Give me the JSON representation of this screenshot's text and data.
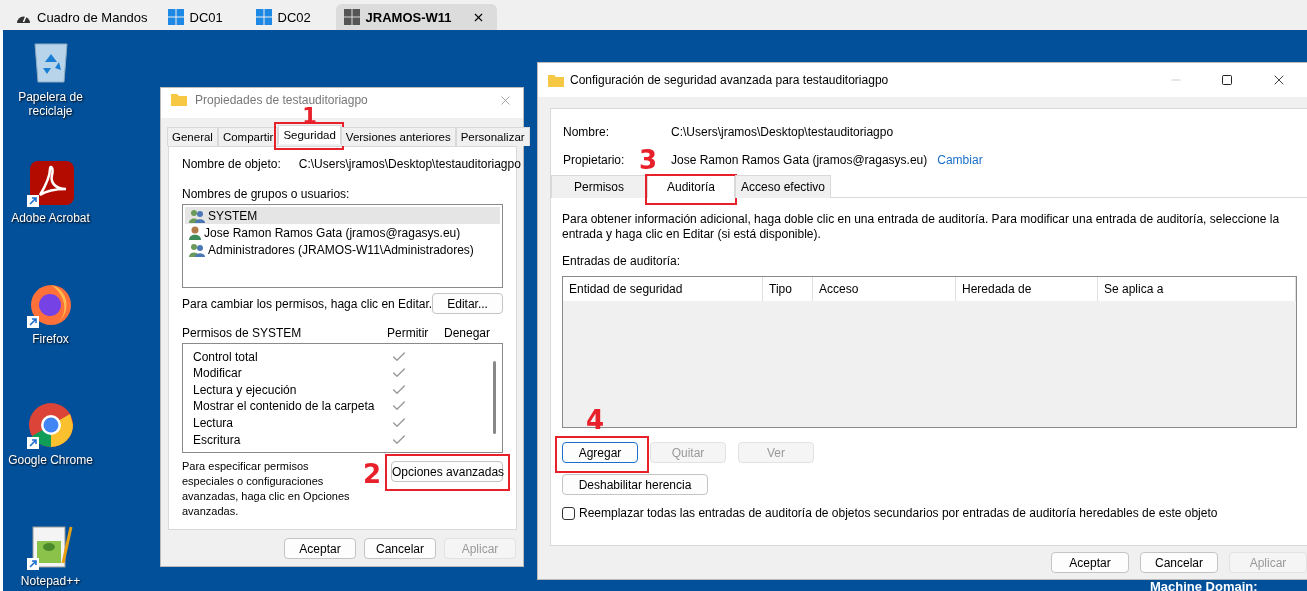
{
  "tabs": [
    {
      "label": "Cuadro de Mandos",
      "selected": false,
      "kind": "dashboard"
    },
    {
      "label": "DC01",
      "selected": false,
      "kind": "windows"
    },
    {
      "label": "DC02",
      "selected": false,
      "kind": "windows"
    },
    {
      "label": "JRAMOS-W11",
      "selected": true,
      "kind": "windows"
    }
  ],
  "desktop_icons": [
    {
      "label": "Papelera de reciclaje",
      "kind": "recycle",
      "shortcut": false
    },
    {
      "label": "Adobe Acrobat",
      "kind": "acrobat",
      "shortcut": true
    },
    {
      "label": "Firefox",
      "kind": "firefox",
      "shortcut": true
    },
    {
      "label": "Google Chrome",
      "kind": "chrome",
      "shortcut": true
    },
    {
      "label": "Notepad++",
      "kind": "notepad",
      "shortcut": true
    }
  ],
  "properties_window": {
    "title": "Propiedades de testauditoriagpo",
    "tabs": [
      {
        "label": "General",
        "selected": false
      },
      {
        "label": "Compartir",
        "selected": false
      },
      {
        "label": "Seguridad",
        "selected": true,
        "callout": "1"
      },
      {
        "label": "Versiones anteriores",
        "selected": false
      },
      {
        "label": "Personalizar",
        "selected": false
      }
    ],
    "object_label": "Nombre de objeto:",
    "object_path": "C:\\Users\\jramos\\Desktop\\testauditoriagpo",
    "groups_label": "Nombres de grupos o usuarios:",
    "groups": [
      {
        "name": "SYSTEM",
        "selected": true,
        "kind": "group"
      },
      {
        "name": "Jose Ramon Ramos Gata (jramos@ragasys.eu)",
        "selected": false,
        "kind": "user"
      },
      {
        "name": "Administradores (JRAMOS-W11\\Administradores)",
        "selected": false,
        "kind": "group"
      }
    ],
    "edit_hint": "Para cambiar los permisos, haga clic en Editar.",
    "edit_button": "Editar...",
    "permissions_label": "Permisos de SYSTEM",
    "allow_label": "Permitir",
    "deny_label": "Denegar",
    "permissions": [
      {
        "name": "Control total",
        "allow": true
      },
      {
        "name": "Modificar",
        "allow": true
      },
      {
        "name": "Lectura y ejecución",
        "allow": true
      },
      {
        "name": "Mostrar el contenido de la carpeta",
        "allow": true
      },
      {
        "name": "Lectura",
        "allow": true
      },
      {
        "name": "Escritura",
        "allow": true
      }
    ],
    "advanced_hint": "Para especificar permisos especiales o configuraciones avanzadas, haga clic en Opciones avanzadas.",
    "advanced_button": {
      "label": "Opciones avanzadas",
      "callout": "2"
    },
    "buttons": [
      {
        "label": "Aceptar",
        "disabled": false
      },
      {
        "label": "Cancelar",
        "disabled": false
      },
      {
        "label": "Aplicar",
        "disabled": true
      }
    ]
  },
  "advanced_window": {
    "title": "Configuración de seguridad avanzada para testauditoriagpo",
    "name_label": "Nombre:",
    "name": "C:\\Users\\jramos\\Desktop\\testauditoriagpo",
    "owner_label": "Propietario:",
    "owner": "Jose Ramon Ramos Gata (jramos@ragasys.eu)",
    "change_link": "Cambiar",
    "tabs": [
      {
        "label": "Permisos",
        "selected": false
      },
      {
        "label": "Auditoría",
        "selected": true,
        "callout": "3"
      },
      {
        "label": "Acceso efectivo",
        "selected": false
      }
    ],
    "description": "Para obtener información adicional, haga doble clic en una entrada de auditoría. Para modificar una entrada de auditoría, seleccione la entrada y haga clic en Editar (si está disponible).",
    "entries_label": "Entradas de auditoría:",
    "columns": [
      "Entidad de seguridad",
      "Tipo",
      "Acceso",
      "Heredada de",
      "Se aplica a"
    ],
    "action_buttons": [
      {
        "label": "Agregar",
        "disabled": false,
        "callout": "4"
      },
      {
        "label": "Quitar",
        "disabled": true
      },
      {
        "label": "Ver",
        "disabled": true
      }
    ],
    "inherit_button": "Deshabilitar herencia",
    "replace_checkbox": {
      "label": "Reemplazar todas las entradas de auditoría de objetos secundarios por entradas de auditoría heredables de este objeto",
      "checked": false
    },
    "buttons": [
      {
        "label": "Aceptar",
        "disabled": false
      },
      {
        "label": "Cancelar",
        "disabled": false
      },
      {
        "label": "Aplicar",
        "disabled": true
      }
    ]
  },
  "machine_domain": "Machine Domain:"
}
